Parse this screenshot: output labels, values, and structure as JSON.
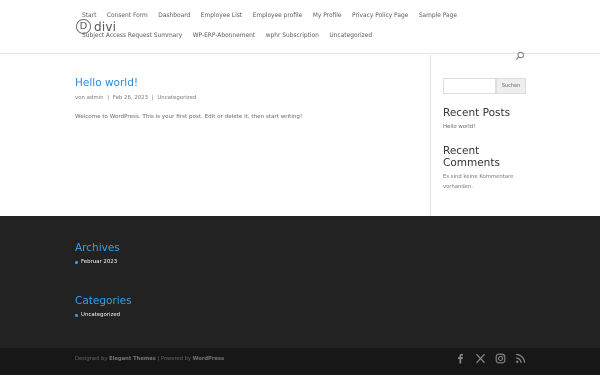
{
  "header": {
    "logo_mark": "D",
    "logo_text": "divi",
    "nav_row1": [
      "Start",
      "Consent Form",
      "Dashboard",
      "Employee List",
      "Employee profile",
      "My Profile",
      "Privacy Policy Page",
      "Sample Page"
    ],
    "nav_row2": [
      "Subject Access Request Summary",
      "WP-ERP-Abonnement",
      "wphr Subscription",
      "Uncategorized"
    ]
  },
  "post": {
    "title": "Hello world!",
    "meta_author": "von admin",
    "meta_date": "Feb 26, 2023",
    "meta_category": "Uncategorized",
    "meta_sep": "|",
    "excerpt": "Welcome to WordPress. This is your first post. Edit or delete it, then start writing!"
  },
  "sidebar": {
    "search_button": "Suchen",
    "recent_posts_title": "Recent Posts",
    "recent_posts_item": "Hello world!",
    "recent_comments_title": "Recent Comments",
    "recent_comments_text": "Es sind keine Kommentare vorhanden."
  },
  "footer": {
    "archives_title": "Archives",
    "archives_item": "Februar 2023",
    "categories_title": "Categories",
    "categories_item": "Uncategorized",
    "credits_prefix": "Designed by",
    "credits_brand": "Elegant Themes",
    "credits_mid": "| Powered by",
    "credits_wp": "WordPress",
    "social": [
      "facebook-icon",
      "x-icon",
      "instagram-icon",
      "rss-icon"
    ],
    "accent": "#2ea3f2"
  }
}
